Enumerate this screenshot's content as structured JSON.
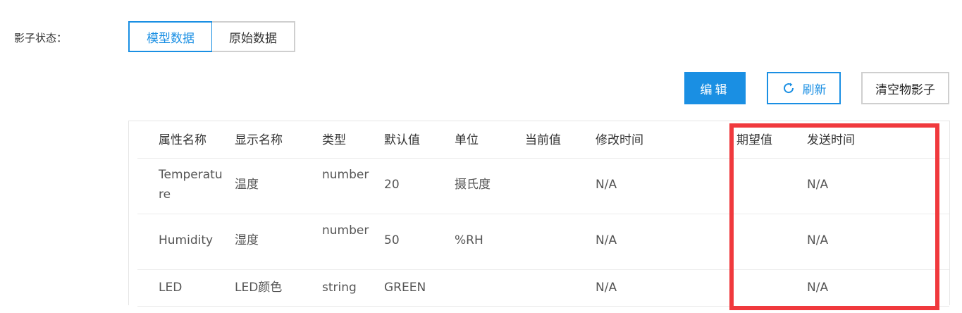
{
  "shadow_label": "影子状态：",
  "tabs": [
    "模型数据",
    "原始数据"
  ],
  "toolbar": {
    "edit": "编辑",
    "refresh": "刷新",
    "clear": "清空物影子"
  },
  "table": {
    "headers": [
      "属性名称",
      "显示名称",
      "类型",
      "默认值",
      "单位",
      "当前值",
      "修改时间",
      "期望值",
      "发送时间"
    ],
    "rows": [
      {
        "name": "Temperature",
        "display": "温度",
        "type": "number",
        "default": "20",
        "unit": "摄氏度",
        "current": "",
        "modified": "N/A",
        "expected": "",
        "sent": "N/A"
      },
      {
        "name": "Humidity",
        "display": "湿度",
        "type": "number",
        "default": "50",
        "unit": "%RH",
        "current": "",
        "modified": "N/A",
        "expected": "",
        "sent": "N/A"
      },
      {
        "name": "LED",
        "display": "LED颜色",
        "type": "string",
        "default": "GREEN",
        "unit": "",
        "current": "",
        "modified": "N/A",
        "expected": "",
        "sent": "N/A"
      }
    ]
  },
  "colors": {
    "accent": "#1a8fe3",
    "highlight": "#f0393d"
  }
}
